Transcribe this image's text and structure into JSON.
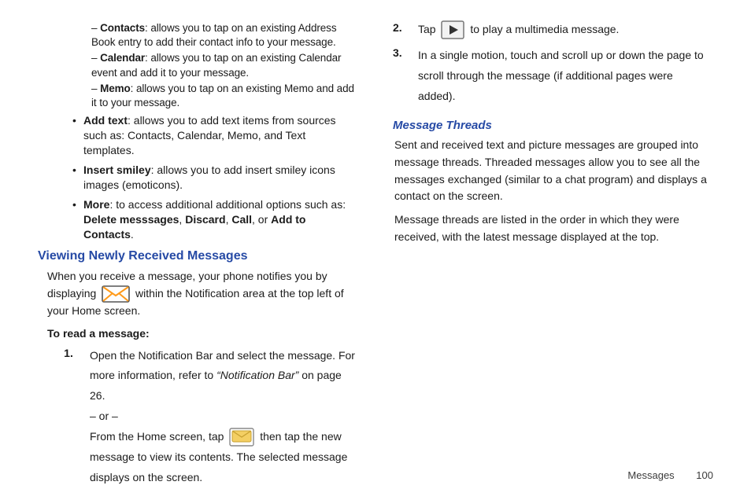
{
  "col1": {
    "contacts_b": "Contacts",
    "contacts_t": ": allows you to tap on an existing Address Book entry to add their contact info to your message.",
    "calendar_b": "Calendar",
    "calendar_t": ": allows you to tap on an existing Calendar event and add it to your message.",
    "memo_b": "Memo",
    "memo_t": ": allows you to tap on an existing Memo and add it to your message.",
    "addtext_b": "Add text",
    "addtext_t": ": allows you to add text items from sources such as: Contacts, Calendar, Memo, and Text templates.",
    "smiley_b": "Insert smiley",
    "smiley_t": ": allows you to add insert smiley icons images (emoticons).",
    "more_b": "More",
    "more_t1": ": to access additional additional options such as: ",
    "more_opts1": "Delete messsages",
    "more_sep": ", ",
    "more_opts2": "Discard",
    "more_opts3": "Call",
    "more_or": ", or ",
    "more_opts4": "Add to Contacts",
    "more_period": ".",
    "heading1": "Viewing Newly Received Messages",
    "para1a": "When you receive a message, your phone notifies you by displaying ",
    "para1b": " within the Notification area at the top left of your Home screen.",
    "toread": "To read a message:",
    "step1_num": "1.",
    "step1a": "Open the Notification Bar and select the message. For more information, refer to ",
    "step1_ref": "“Notification Bar”",
    "step1b": "  on page 26.",
    "step1_or": "– or –",
    "step1c_a": "From the Home screen, tap ",
    "step1c_b": " then tap the new message to view its contents. The selected message displays on the screen."
  },
  "col2": {
    "step2_num": "2.",
    "step2a": "Tap  ",
    "step2b": "  to play a multimedia message.",
    "step3_num": "3.",
    "step3": "In a single motion, touch and scroll up or down the page to scroll through the message (if additional pages were added).",
    "heading2": "Message Threads",
    "para2": "Sent and received text and picture messages are grouped into message threads. Threaded messages allow you to see all the messages exchanged (similar to a chat program) and displays a contact on the screen.",
    "para3": "Message threads are listed in the order in which they were received, with the latest message displayed at the top."
  },
  "footer": {
    "section": "Messages",
    "page": "100"
  }
}
